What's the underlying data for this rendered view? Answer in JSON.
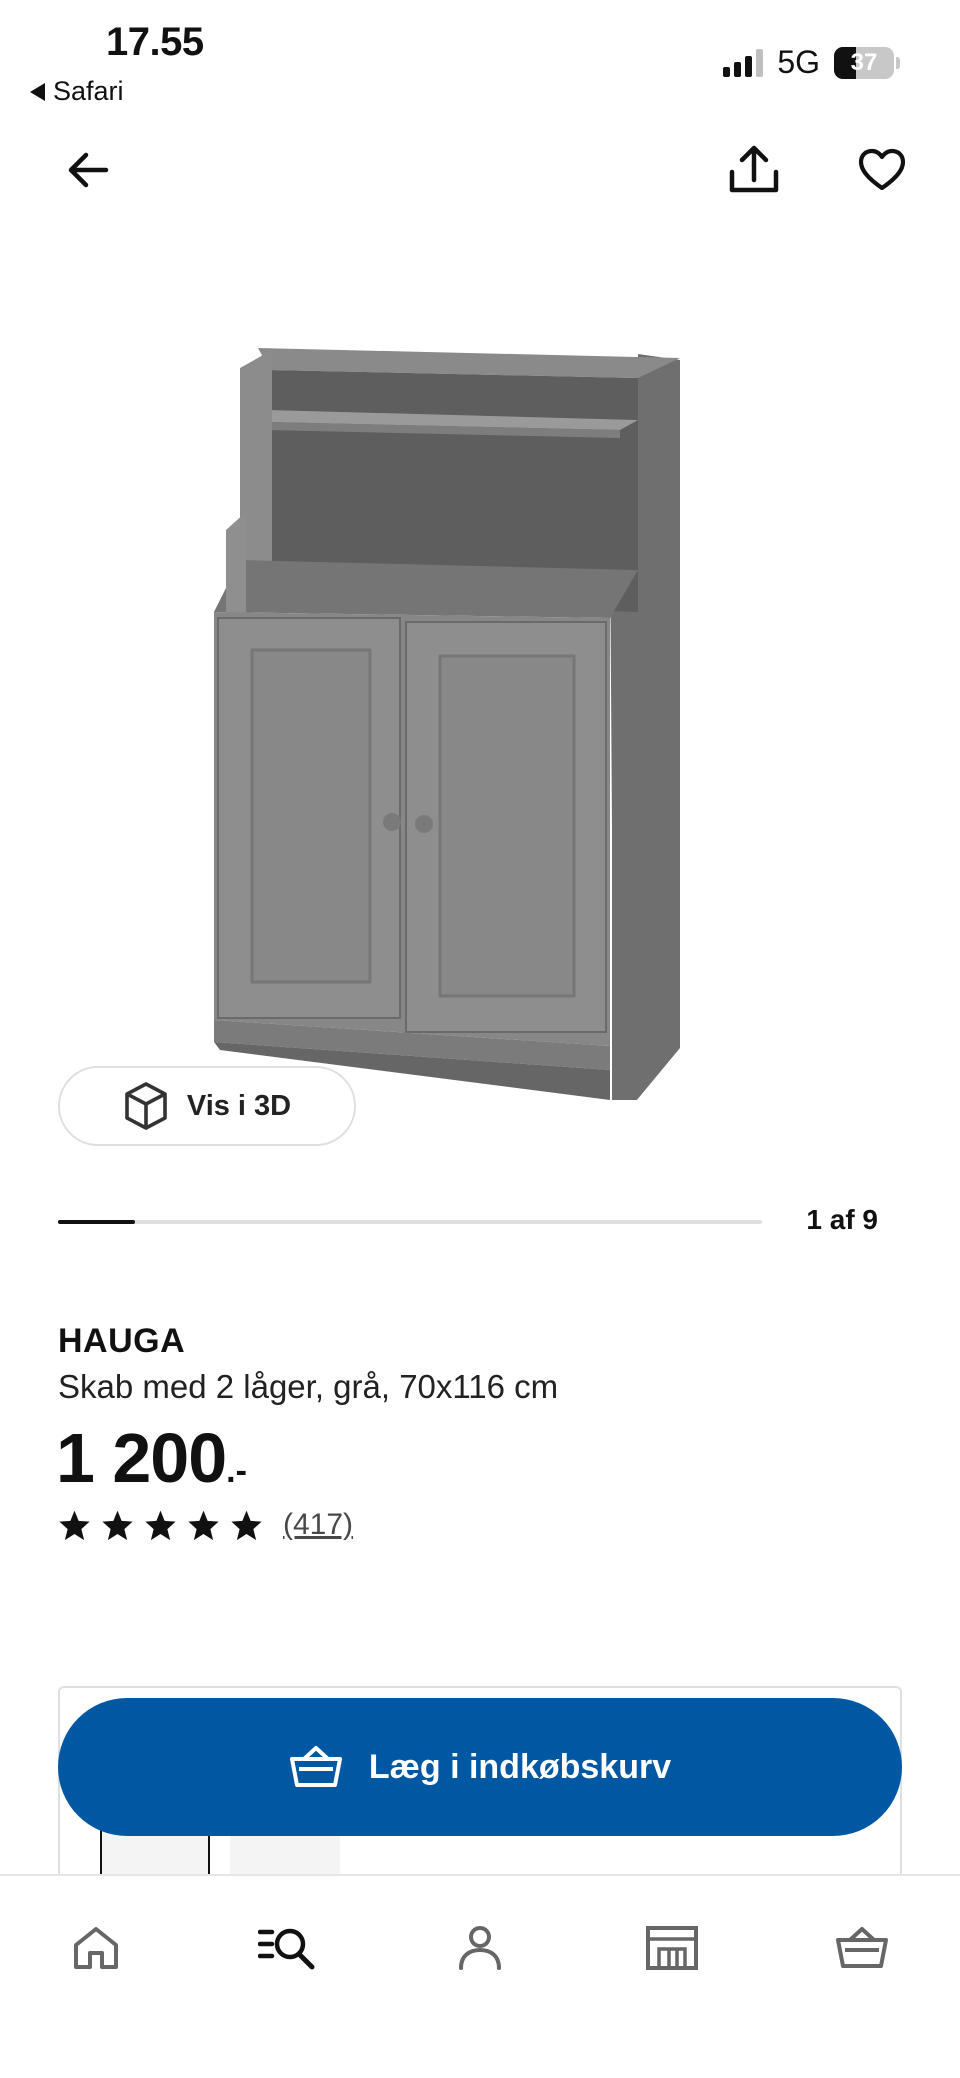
{
  "status_bar": {
    "time": "17.55",
    "back_app": "Safari",
    "network": "5G",
    "battery": "37"
  },
  "top_nav": {
    "back_icon": "arrow-left-icon",
    "share_icon": "share-icon",
    "favorite_icon": "heart-icon"
  },
  "gallery": {
    "view_3d_label": "Vis i 3D",
    "counter": "1 af 9",
    "progress": 0.11
  },
  "product": {
    "name": "HAUGA",
    "description": "Skab med 2 låger, grå, 70x116 cm",
    "price": "1 200",
    "price_suffix": ".-",
    "rating": 5,
    "review_count": "(417)"
  },
  "cart": {
    "label": "Læg i indkøbskurv",
    "icon": "basket-icon"
  },
  "tabbar": {
    "items": [
      "home-icon",
      "search-icon",
      "profile-icon",
      "store-icon",
      "basket-icon"
    ]
  }
}
